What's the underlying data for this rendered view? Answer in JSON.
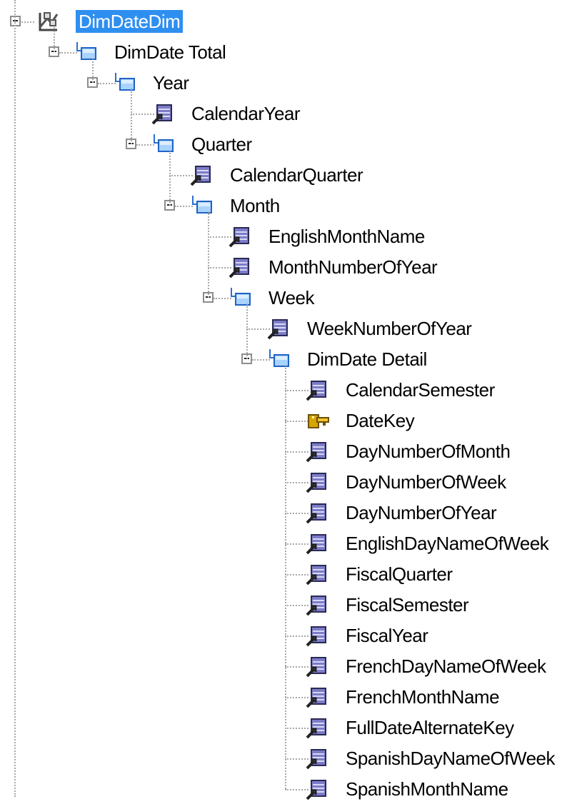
{
  "tree": {
    "root": {
      "label": "DimDateDim",
      "icon": "dimension-icon",
      "selected": true,
      "expanded": true
    },
    "nodes": [
      {
        "label": "DimDate Total",
        "type": "level",
        "icon": "level-icon",
        "expandable": true
      },
      {
        "label": "Year",
        "type": "level",
        "icon": "level-icon",
        "expandable": true
      },
      {
        "label": "CalendarYear",
        "type": "attribute",
        "icon": "attribute-icon",
        "expandable": false
      },
      {
        "label": "Quarter",
        "type": "level",
        "icon": "level-icon",
        "expandable": true
      },
      {
        "label": "CalendarQuarter",
        "type": "attribute",
        "icon": "attribute-icon",
        "expandable": false
      },
      {
        "label": "Month",
        "type": "level",
        "icon": "level-icon",
        "expandable": true
      },
      {
        "label": "EnglishMonthName",
        "type": "attribute",
        "icon": "attribute-icon",
        "expandable": false
      },
      {
        "label": "MonthNumberOfYear",
        "type": "attribute",
        "icon": "attribute-icon",
        "expandable": false
      },
      {
        "label": "Week",
        "type": "level",
        "icon": "level-icon",
        "expandable": true
      },
      {
        "label": "WeekNumberOfYear",
        "type": "attribute",
        "icon": "attribute-icon",
        "expandable": false
      },
      {
        "label": "DimDate Detail",
        "type": "level",
        "icon": "level-icon",
        "expandable": true
      },
      {
        "label": "CalendarSemester",
        "type": "attribute",
        "icon": "attribute-icon",
        "expandable": false
      },
      {
        "label": "DateKey",
        "type": "key",
        "icon": "key-icon",
        "expandable": false
      },
      {
        "label": "DayNumberOfMonth",
        "type": "attribute",
        "icon": "attribute-icon",
        "expandable": false
      },
      {
        "label": "DayNumberOfWeek",
        "type": "attribute",
        "icon": "attribute-icon",
        "expandable": false
      },
      {
        "label": "DayNumberOfYear",
        "type": "attribute",
        "icon": "attribute-icon",
        "expandable": false
      },
      {
        "label": "EnglishDayNameOfWeek",
        "type": "attribute",
        "icon": "attribute-icon",
        "expandable": false
      },
      {
        "label": "FiscalQuarter",
        "type": "attribute",
        "icon": "attribute-icon",
        "expandable": false
      },
      {
        "label": "FiscalSemester",
        "type": "attribute",
        "icon": "attribute-icon",
        "expandable": false
      },
      {
        "label": "FiscalYear",
        "type": "attribute",
        "icon": "attribute-icon",
        "expandable": false
      },
      {
        "label": "FrenchDayNameOfWeek",
        "type": "attribute",
        "icon": "attribute-icon",
        "expandable": false
      },
      {
        "label": "FrenchMonthName",
        "type": "attribute",
        "icon": "attribute-icon",
        "expandable": false
      },
      {
        "label": "FullDateAlternateKey",
        "type": "attribute",
        "icon": "attribute-icon",
        "expandable": false
      },
      {
        "label": "SpanishDayNameOfWeek",
        "type": "attribute",
        "icon": "attribute-icon",
        "expandable": false
      },
      {
        "label": "SpanishMonthName",
        "type": "attribute",
        "icon": "attribute-icon",
        "expandable": false
      }
    ]
  },
  "colors": {
    "selection": "#2f8ff0",
    "treeLine": "#a8a8a8"
  }
}
